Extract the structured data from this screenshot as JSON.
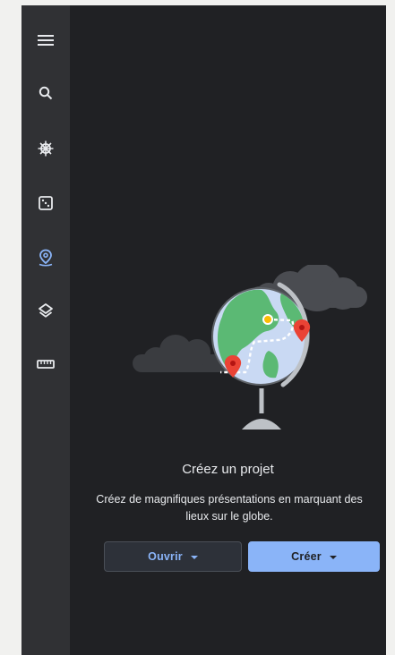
{
  "sidebar": {
    "items": [
      {
        "name": "menu",
        "icon": "menu-icon",
        "active": false
      },
      {
        "name": "search",
        "icon": "search-icon",
        "active": false
      },
      {
        "name": "voyager",
        "icon": "ship-wheel-icon",
        "active": false
      },
      {
        "name": "feeling-lucky",
        "icon": "dice-icon",
        "active": false
      },
      {
        "name": "projects",
        "icon": "location-pin-icon",
        "active": true
      },
      {
        "name": "map-style",
        "icon": "layers-icon",
        "active": false
      },
      {
        "name": "measure",
        "icon": "ruler-icon",
        "active": false
      }
    ],
    "icon_color": "#e8eaed",
    "active_color": "#8ab4f8"
  },
  "panel": {
    "illustration": "globe-with-pins-icon",
    "title": "Créez un projet",
    "description": "Créez de magnifiques présentations en marquant des lieux sur le globe.",
    "open_button": "Ouvrir",
    "create_button": "Créer"
  },
  "colors": {
    "accent": "#8ab4f8",
    "background": "#202124",
    "rail": "#303134"
  }
}
